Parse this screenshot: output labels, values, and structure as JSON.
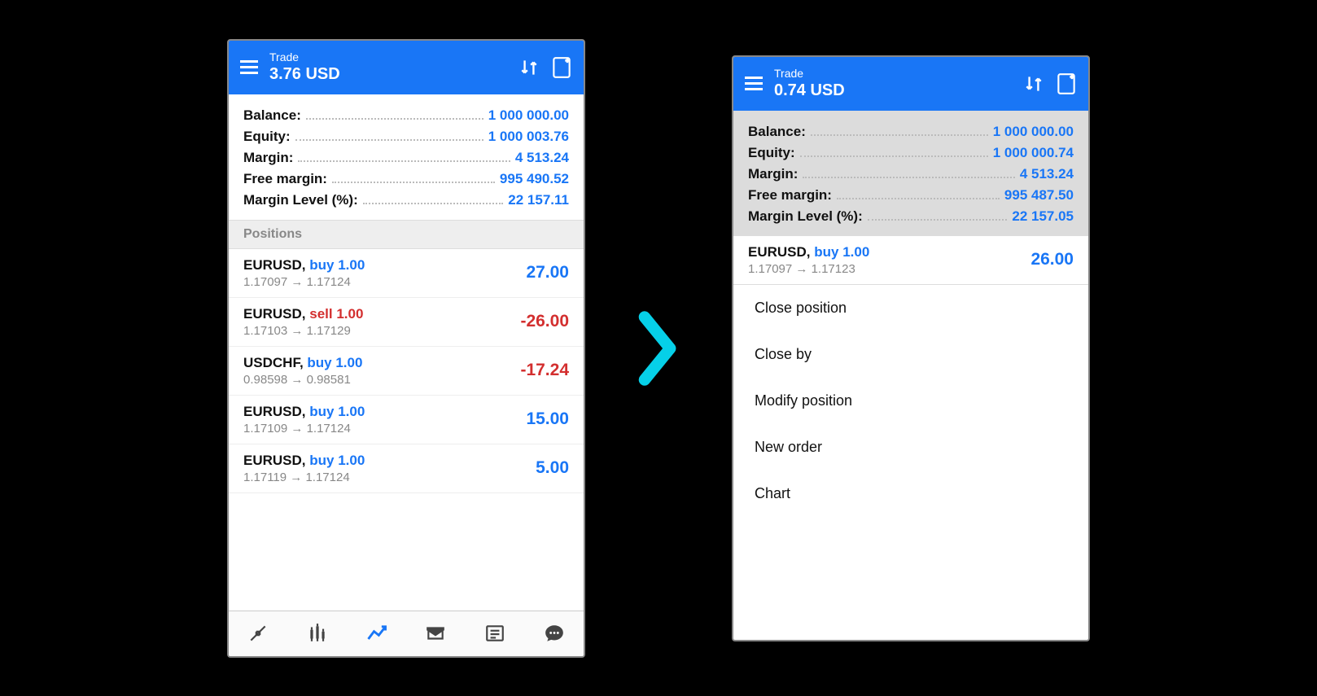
{
  "left": {
    "header": {
      "title": "Trade",
      "subtitle": "3.76 USD"
    },
    "summary": [
      {
        "label": "Balance:",
        "value": "1 000 000.00"
      },
      {
        "label": "Equity:",
        "value": "1 000 003.76"
      },
      {
        "label": "Margin:",
        "value": "4 513.24"
      },
      {
        "label": "Free margin:",
        "value": "995 490.52"
      },
      {
        "label": "Margin Level (%):",
        "value": "22 157.11"
      }
    ],
    "positions_header": "Positions",
    "positions": [
      {
        "pair": "EURUSD,",
        "side": "buy 1.00",
        "side_type": "buy",
        "from": "1.17097",
        "to": "1.17124",
        "pl": "27.00",
        "pl_sign": "pos"
      },
      {
        "pair": "EURUSD,",
        "side": "sell 1.00",
        "side_type": "sell",
        "from": "1.17103",
        "to": "1.17129",
        "pl": "-26.00",
        "pl_sign": "neg"
      },
      {
        "pair": "USDCHF,",
        "side": "buy 1.00",
        "side_type": "buy",
        "from": "0.98598",
        "to": "0.98581",
        "pl": "-17.24",
        "pl_sign": "neg"
      },
      {
        "pair": "EURUSD,",
        "side": "buy 1.00",
        "side_type": "buy",
        "from": "1.17109",
        "to": "1.17124",
        "pl": "15.00",
        "pl_sign": "pos"
      },
      {
        "pair": "EURUSD,",
        "side": "buy 1.00",
        "side_type": "buy",
        "from": "1.17119",
        "to": "1.17124",
        "pl": "5.00",
        "pl_sign": "pos"
      }
    ]
  },
  "right": {
    "header": {
      "title": "Trade",
      "subtitle": "0.74 USD"
    },
    "summary": [
      {
        "label": "Balance:",
        "value": "1 000 000.00"
      },
      {
        "label": "Equity:",
        "value": "1 000 000.74"
      },
      {
        "label": "Margin:",
        "value": "4 513.24"
      },
      {
        "label": "Free margin:",
        "value": "995 487.50"
      },
      {
        "label": "Margin Level (%):",
        "value": "22 157.05"
      }
    ],
    "selected": {
      "pair": "EURUSD,",
      "side": "buy 1.00",
      "from": "1.17097",
      "to": "1.17123",
      "pl": "26.00"
    },
    "menu": [
      "Close position",
      "Close by",
      "Modify position",
      "New order",
      "Chart"
    ]
  },
  "arrow_glyph": "→"
}
